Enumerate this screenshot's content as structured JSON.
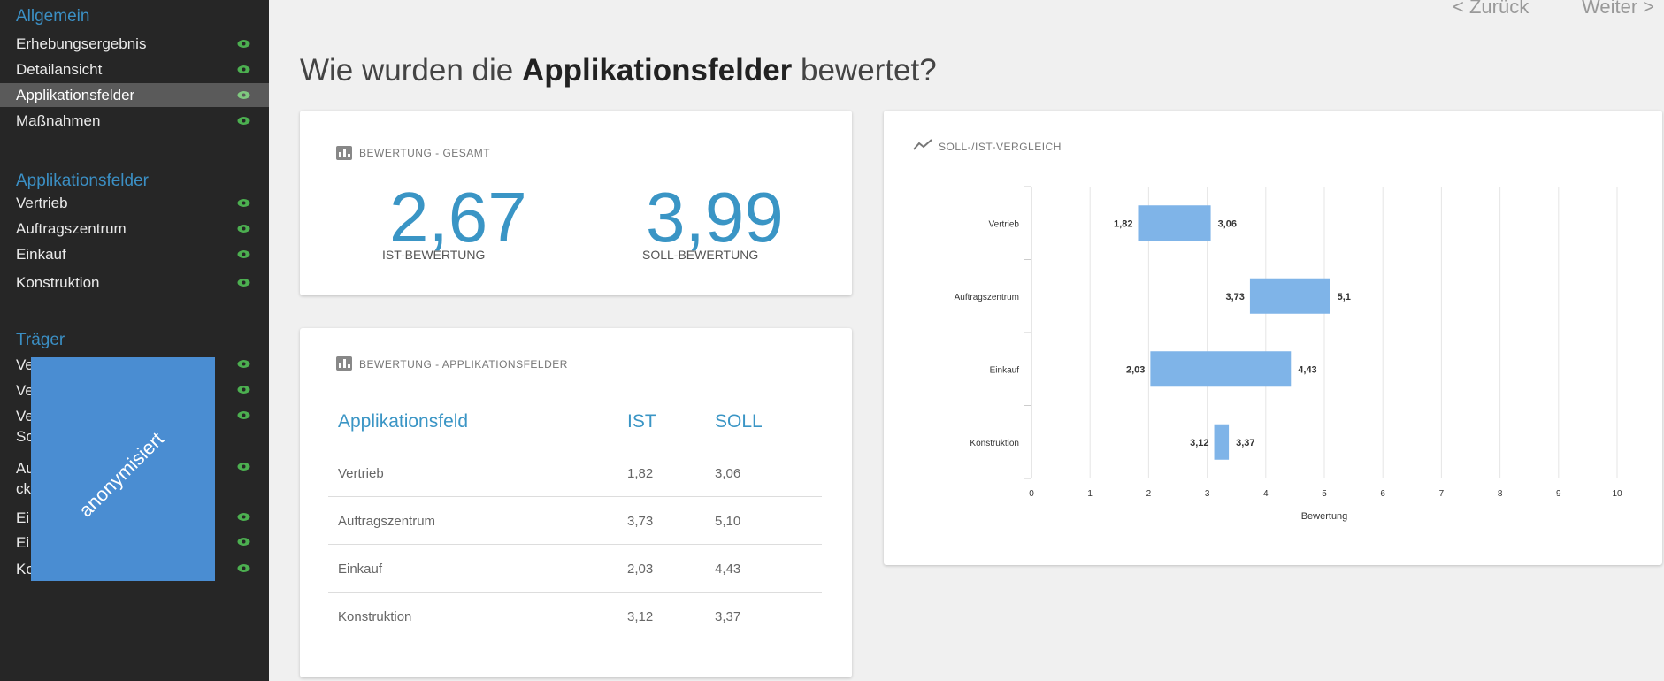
{
  "sidebar": {
    "sections": [
      {
        "heading": "Allgemein",
        "items": [
          "Erhebungsergebnis",
          "Detailansicht",
          "Applikationsfelder",
          "Maßnahmen"
        ]
      },
      {
        "heading": "Applikationsfelder",
        "items": [
          "Vertrieb",
          "Auftragszentrum",
          "Einkauf",
          "Konstruktion"
        ]
      },
      {
        "heading": "Träger",
        "items": []
      }
    ],
    "active_item": "Applikationsfelder",
    "partial_items": [
      "Ve",
      "Ve",
      "Ve",
      "Sc",
      "Au",
      "ck",
      "Ei",
      "Ei",
      "Ko"
    ],
    "overlay_text": "anonymisiert",
    "overlay_color": "#4a8dd2",
    "eye_icon_color": "#4caf50"
  },
  "nav": {
    "prev": "< Zurück",
    "next": "Weiter >"
  },
  "page_title": {
    "prefix": "Wie wurden die ",
    "bold": "Applikationsfelder",
    "suffix": " bewertet?"
  },
  "card_total": {
    "title": "BEWERTUNG - GESAMT",
    "ist_value": "2,67",
    "ist_label": "IST-BEWERTUNG",
    "soll_value": "3,99",
    "soll_label": "SOLL-BEWERTUNG"
  },
  "card_table": {
    "title": "BEWERTUNG - APPLIKATIONSFELDER",
    "columns": [
      "Applikationsfeld",
      "IST",
      "SOLL"
    ],
    "rows": [
      [
        "Vertrieb",
        "1,82",
        "3,06"
      ],
      [
        "Auftragszentrum",
        "3,73",
        "5,10"
      ],
      [
        "Einkauf",
        "2,03",
        "4,43"
      ],
      [
        "Konstruktion",
        "3,12",
        "3,37"
      ]
    ]
  },
  "card_chart": {
    "title": "SOLL-/IST-VERGLEICH"
  },
  "chart_data": {
    "type": "bar",
    "orientation": "horizontal-range",
    "title": "SOLL-/IST-VERGLEICH",
    "categories": [
      "Vertrieb",
      "Auftragszentrum",
      "Einkauf",
      "Konstruktion"
    ],
    "series": [
      {
        "name": "IST",
        "values": [
          1.82,
          3.73,
          2.03,
          3.12
        ]
      },
      {
        "name": "SOLL",
        "values": [
          3.06,
          5.1,
          4.43,
          3.37
        ]
      }
    ],
    "low_labels": [
      "1,82",
      "3,73",
      "2,03",
      "3,12"
    ],
    "high_labels": [
      "3,06",
      "5,1",
      "4,43",
      "3,37"
    ],
    "xlabel": "Bewertung",
    "ylabel": "",
    "xlim": [
      0,
      10
    ],
    "xticks": [
      "0",
      "1",
      "2",
      "3",
      "4",
      "5",
      "6",
      "7",
      "8",
      "9",
      "10"
    ],
    "grid": true,
    "bar_color": "#7fb4e8"
  }
}
